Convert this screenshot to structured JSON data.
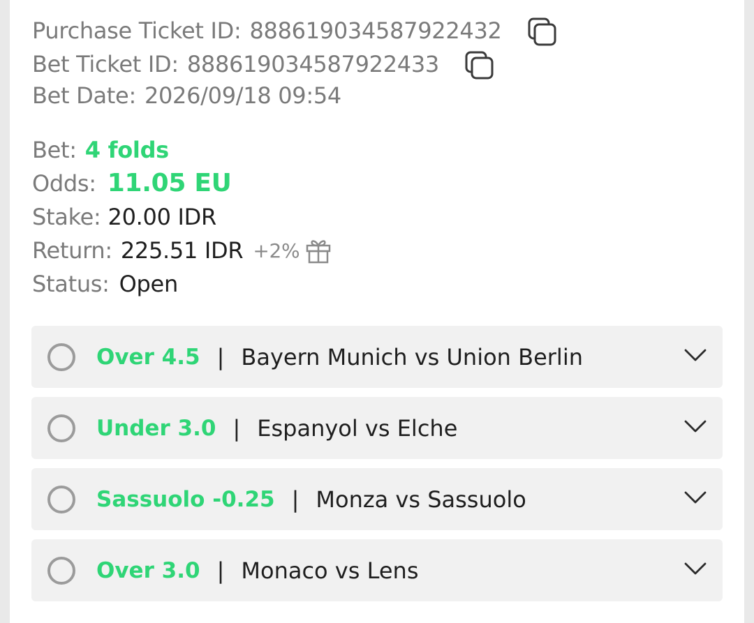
{
  "ticket": {
    "purchase_label": "Purchase Ticket ID:",
    "purchase_id": "888619034587922432",
    "bet_ticket_label": "Bet Ticket ID:",
    "bet_ticket_id": "888619034587922433",
    "bet_date_label": "Bet Date:",
    "bet_date": "2026/09/18 09:54"
  },
  "summary": {
    "bet_label": "Bet:",
    "bet_value": "4 folds",
    "odds_label": "Odds:",
    "odds_value": "11.05 EU",
    "stake_label": "Stake:",
    "stake_value": "20.00 IDR",
    "return_label": "Return:",
    "return_value": "225.51 IDR",
    "return_bonus": "+2%",
    "status_label": "Status:",
    "status_value": "Open"
  },
  "legs": [
    {
      "pick": "Over 4.5",
      "separator": "|",
      "match": "Bayern Munich vs Union Berlin"
    },
    {
      "pick": "Under 3.0",
      "separator": "|",
      "match": "Espanyol vs Elche"
    },
    {
      "pick": "Sassuolo -0.25",
      "separator": "|",
      "match": "Monza vs Sassuolo"
    },
    {
      "pick": "Over 3.0",
      "separator": "|",
      "match": "Monaco vs Lens"
    }
  ],
  "icons": {
    "copy": "copy-icon",
    "gift": "gift-icon",
    "expand": "chevron-down-icon"
  },
  "colors": {
    "accent_green": "#2fd576",
    "label_gray": "#7a7a7a",
    "text_dark": "#1e1e1e",
    "row_bg": "#f1f1f1",
    "page_bg": "#e9e9e9"
  }
}
